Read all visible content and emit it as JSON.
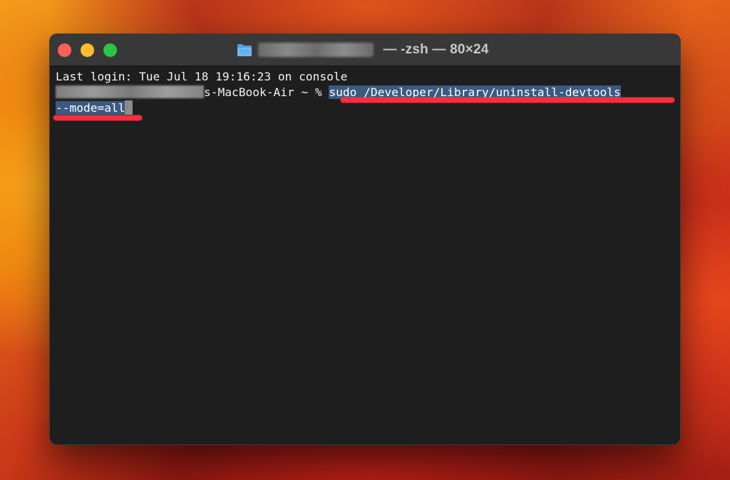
{
  "window": {
    "title_suffix": " — -zsh — 80×24"
  },
  "terminal": {
    "last_login": "Last login: Tue Jul 18 19:16:23 on console",
    "prompt_host": "s-MacBook-Air ~ % ",
    "command_line1": "sudo /Developer/Library/uninstall-devtools",
    "command_line2": "--mode=all"
  },
  "icons": {
    "close": "close-button-icon",
    "minimize": "minimize-button-icon",
    "zoom": "zoom-button-icon",
    "folder": "folder-icon"
  },
  "colors": {
    "close": "#ff5f57",
    "minimize": "#febc2e",
    "zoom": "#28c840",
    "selection": "#3b5a80",
    "annotation": "#ff2d3d"
  }
}
